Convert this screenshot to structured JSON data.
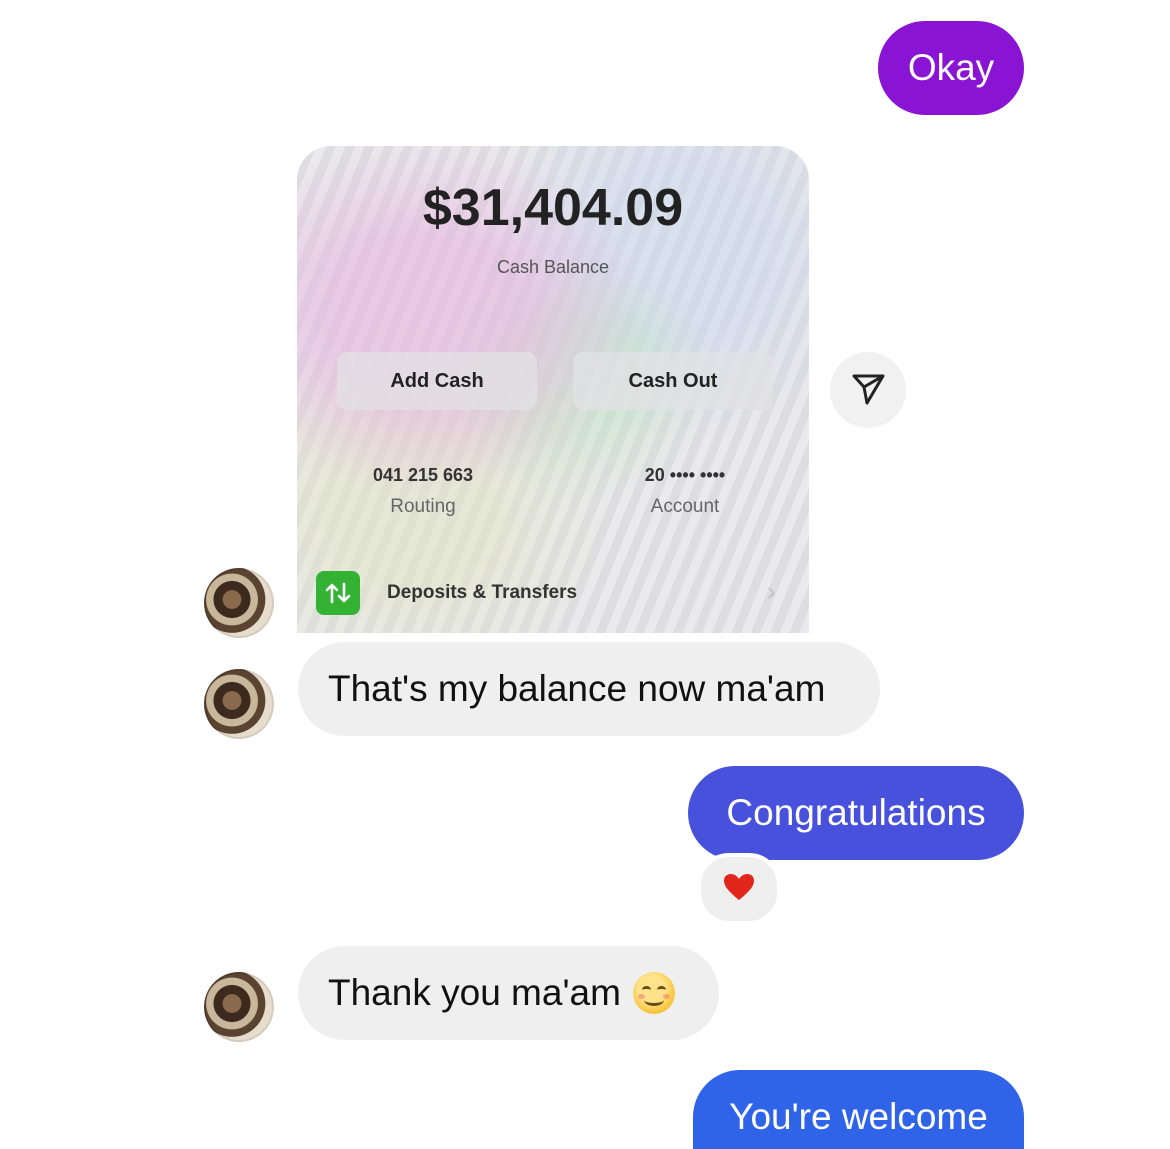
{
  "colors": {
    "okay_bubble": "#8a14d4",
    "congrats_bubble": "#4851dc",
    "welcome_bubble": "#2f63e8",
    "incoming_bubble": "#efefef",
    "deposit_icon": "#34b233",
    "heart": "#e2261c"
  },
  "messages": [
    {
      "from": "me",
      "text": "Okay"
    },
    {
      "from": "them",
      "text": "That's my balance now ma'am"
    },
    {
      "from": "me",
      "text": "Congratulations",
      "reaction": "heart-icon"
    },
    {
      "from": "them",
      "text": "Thank you ma'am",
      "emoji": "smiling-face-icon"
    },
    {
      "from": "me",
      "text": "You're welcome"
    }
  ],
  "balance_card": {
    "amount": "$31,404.09",
    "amount_label": "Cash Balance",
    "add_cash": "Add Cash",
    "cash_out": "Cash Out",
    "routing_number": "041 215 663",
    "routing_label": "Routing",
    "account_number": "20 •••• ••••",
    "account_label": "Account",
    "deposits_label": "Deposits & Transfers"
  },
  "icons": {
    "share": "paper-plane-icon",
    "deposits": "up-down-arrows-icon",
    "chevron": "chevron-right-icon",
    "reaction": "heart-icon",
    "emoji": "smiling-face-icon"
  }
}
